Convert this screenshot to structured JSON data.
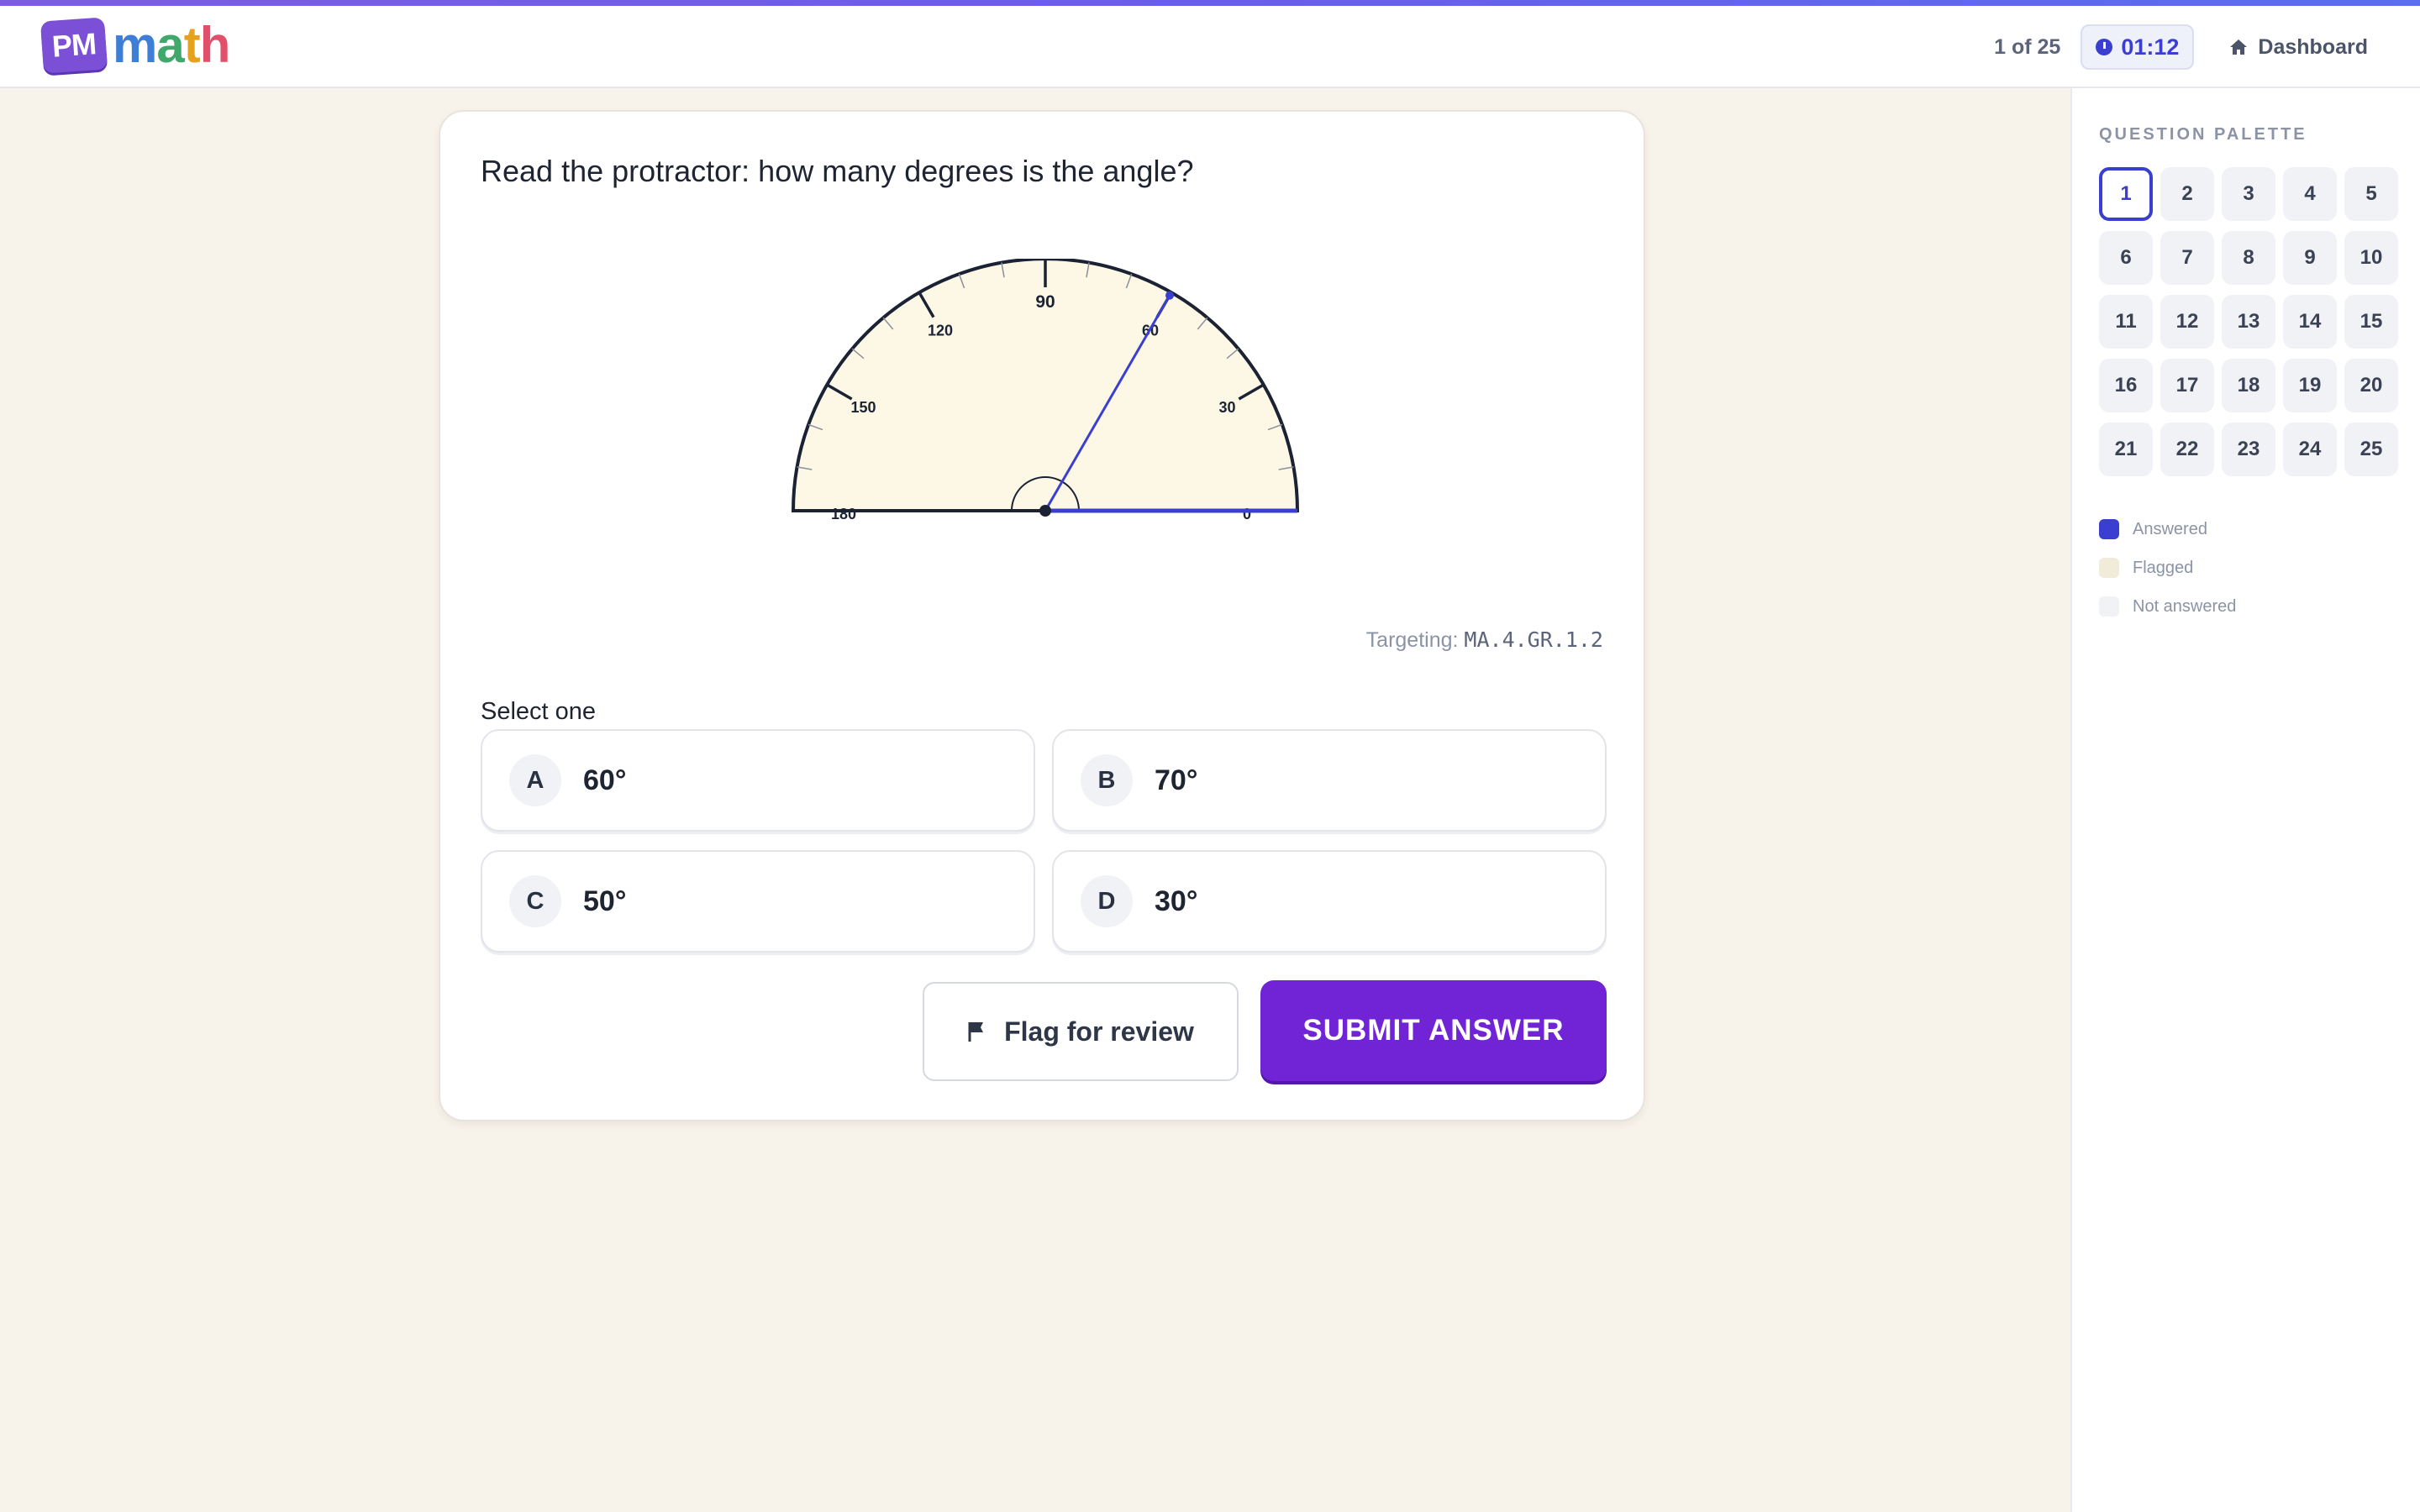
{
  "header": {
    "logo_badge": "PM",
    "logo_word": [
      "m",
      "a",
      "t",
      "h"
    ],
    "progress": "1 of 25",
    "timer": "01:12",
    "dashboard": "Dashboard"
  },
  "question": {
    "prompt": "Read the protractor: how many degrees is the angle?",
    "targeting_label": "Targeting:",
    "targeting_code": "MA.4.GR.1.2",
    "select_label": "Select one",
    "protractor": {
      "labels": [
        "180",
        "150",
        "120",
        "90",
        "60",
        "30",
        "0"
      ],
      "pointer_angle_deg": 60,
      "colors": {
        "fill": "#fdf8e6",
        "stroke": "#1b2233",
        "ray": "#3a3fd1"
      }
    },
    "choices": [
      {
        "letter": "A",
        "value": "60°"
      },
      {
        "letter": "B",
        "value": "70°"
      },
      {
        "letter": "C",
        "value": "50°"
      },
      {
        "letter": "D",
        "value": "30°"
      }
    ],
    "flag_label": "Flag for review",
    "submit_label": "SUBMIT ANSWER"
  },
  "palette": {
    "title": "QUESTION PALETTE",
    "numbers": [
      "1",
      "2",
      "3",
      "4",
      "5",
      "6",
      "7",
      "8",
      "9",
      "10",
      "11",
      "12",
      "13",
      "14",
      "15",
      "16",
      "17",
      "18",
      "19",
      "20",
      "21",
      "22",
      "23",
      "24",
      "25"
    ],
    "current": "1",
    "legend": [
      {
        "label": "Answered",
        "color": "#3a3fd1"
      },
      {
        "label": "Flagged",
        "color": "#f1ecd9"
      },
      {
        "label": "Not answered",
        "color": "#f1f2f5"
      }
    ]
  }
}
